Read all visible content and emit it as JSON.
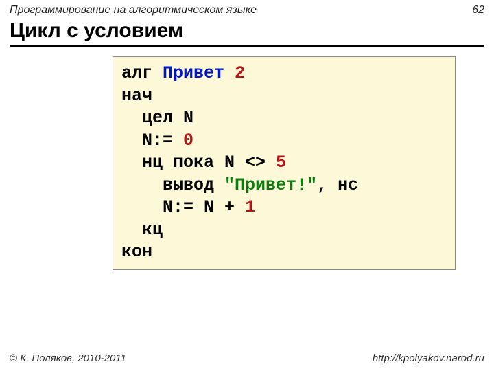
{
  "header": {
    "topic": "Программирование на алгоритмическом языке",
    "page": "62"
  },
  "title": "Цикл с условием",
  "code": {
    "l1a": "алг ",
    "l1b": "Привет ",
    "l1c": "2",
    "l2": "нач",
    "l3": "  цел N",
    "l4a": "  N:= ",
    "l4b": "0",
    "l5a": "  нц пока N <> ",
    "l5b": "5",
    "l6a": "    вывод ",
    "l6b": "\"Привет!\"",
    "l6c": ", нс",
    "l7a": "    N:= N + ",
    "l7b": "1",
    "l8": "  кц",
    "l9": "кон"
  },
  "footer": {
    "copyright": "© К. Поляков, 2010-2011",
    "url": "http://kpolyakov.narod.ru"
  }
}
